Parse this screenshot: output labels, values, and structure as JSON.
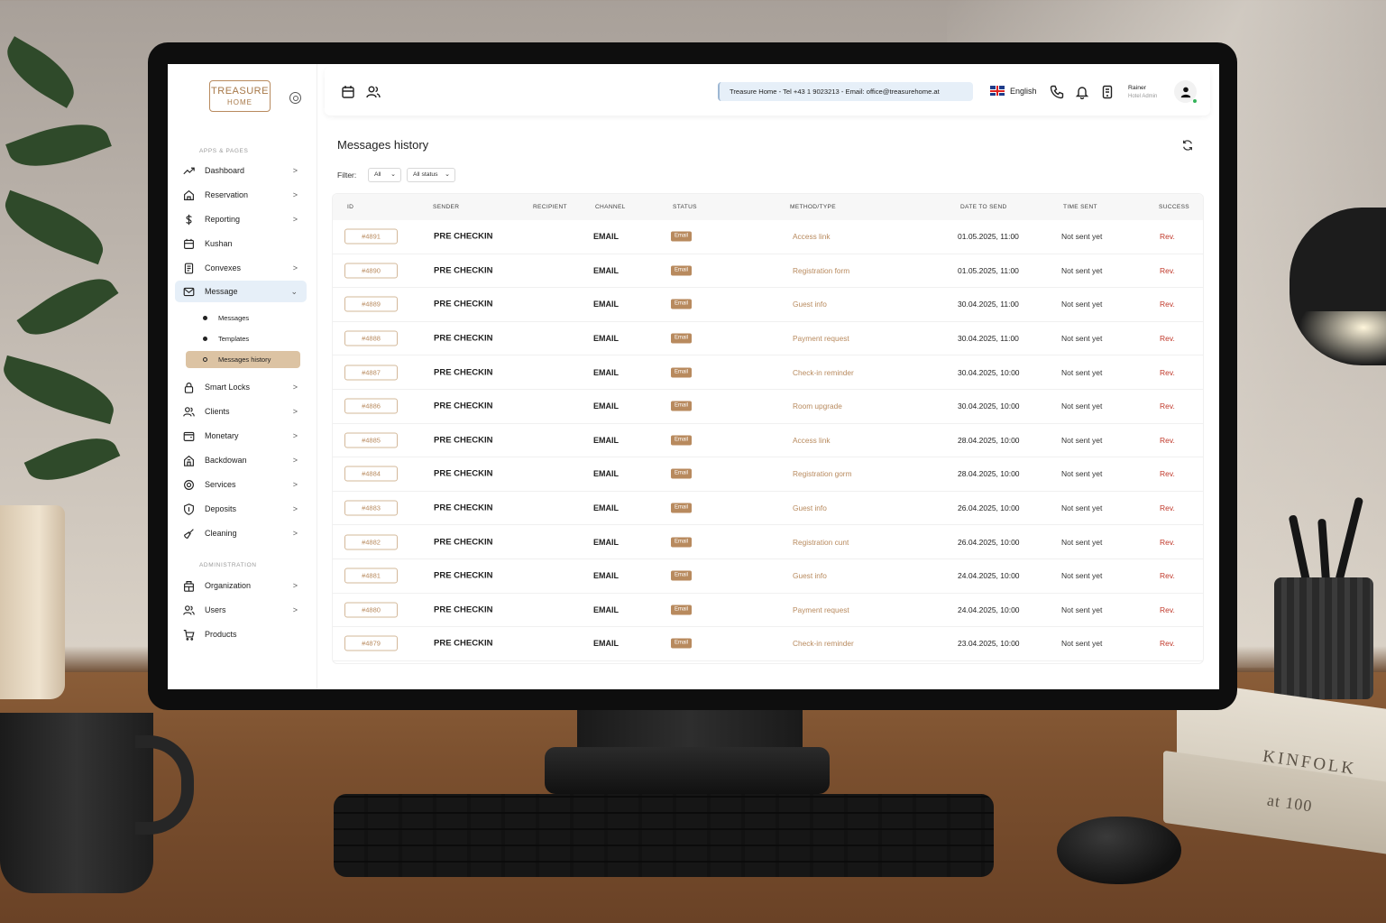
{
  "app": {
    "logo_line1": "TREASURE",
    "logo_line2": "HOME"
  },
  "sidebar": {
    "section_apps": "APPS & PAGES",
    "section_admin": "ADMINISTRATION",
    "items": [
      {
        "label": "Dashboard",
        "icon": "trend-icon",
        "chevron": ">"
      },
      {
        "label": "Reservation",
        "icon": "home-icon",
        "chevron": ">"
      },
      {
        "label": "Reporting",
        "icon": "dollar-icon",
        "chevron": ">"
      },
      {
        "label": "Kushan",
        "icon": "calendar-icon",
        "chevron": ""
      },
      {
        "label": "Convexes",
        "icon": "receipt-icon",
        "chevron": ">"
      },
      {
        "label": "Message",
        "icon": "mail-icon",
        "chevron": "⌄"
      },
      {
        "label": "Smart Locks",
        "icon": "lock-icon",
        "chevron": ">"
      },
      {
        "label": "Clients",
        "icon": "users-icon",
        "chevron": ">"
      },
      {
        "label": "Monetary",
        "icon": "wallet-icon",
        "chevron": ">"
      },
      {
        "label": "Backdowan",
        "icon": "building-icon",
        "chevron": ">"
      },
      {
        "label": "Services",
        "icon": "settings-icon",
        "chevron": ">"
      },
      {
        "label": "Deposits",
        "icon": "shield-icon",
        "chevron": ">"
      },
      {
        "label": "Cleaning",
        "icon": "broom-icon",
        "chevron": ">"
      },
      {
        "label": "Organization",
        "icon": "organization-icon",
        "chevron": ">"
      },
      {
        "label": "Users",
        "icon": "users-icon",
        "chevron": ">"
      },
      {
        "label": "Products",
        "icon": "cart-icon",
        "chevron": ""
      }
    ],
    "sub_items": [
      "Messages",
      "Templates",
      "Messages history"
    ]
  },
  "topbar": {
    "info": "Treasure Home - Tel +43 1 9023213 - Email: office@treasurehome.at",
    "language": "English",
    "user_name": "Rainer",
    "user_role": "Hotel Admin"
  },
  "main": {
    "title": "Messages history",
    "filter_label": "Filter:",
    "filter_all": "All",
    "filter_status": "All status",
    "columns": [
      "ID",
      "SENDER",
      "RECIPIENT",
      "CHANNEL",
      "STATUS",
      "METHOD/TYPE",
      "DATE TO SEND",
      "TIME SENT",
      "SUCCESS"
    ],
    "rows": [
      {
        "id": "#4891",
        "sender": "PRE CHECKIN",
        "recipient": "",
        "channel": "EMAIL",
        "status": "Email",
        "method": "Access link",
        "date": "01.05.2025, 11:00",
        "time_sent": "Not sent yet",
        "success": "Rev."
      },
      {
        "id": "#4890",
        "sender": "PRE CHECKIN",
        "recipient": "",
        "channel": "EMAIL",
        "status": "Email",
        "method": "Registration form",
        "date": "01.05.2025, 11:00",
        "time_sent": "Not sent yet",
        "success": "Rev."
      },
      {
        "id": "#4889",
        "sender": "PRE CHECKIN",
        "recipient": "",
        "channel": "EMAIL",
        "status": "Email",
        "method": "Guest info",
        "date": "30.04.2025, 11:00",
        "time_sent": "Not sent yet",
        "success": "Rev."
      },
      {
        "id": "#4888",
        "sender": "PRE CHECKIN",
        "recipient": "",
        "channel": "EMAIL",
        "status": "Email",
        "method": "Payment request",
        "date": "30.04.2025, 11:00",
        "time_sent": "Not sent yet",
        "success": "Rev."
      },
      {
        "id": "#4887",
        "sender": "PRE CHECKIN",
        "recipient": "",
        "channel": "EMAIL",
        "status": "Email",
        "method": "Check-in reminder",
        "date": "30.04.2025, 10:00",
        "time_sent": "Not sent yet",
        "success": "Rev."
      },
      {
        "id": "#4886",
        "sender": "PRE CHECKIN",
        "recipient": "",
        "channel": "EMAIL",
        "status": "Email",
        "method": "Room upgrade",
        "date": "30.04.2025, 10:00",
        "time_sent": "Not sent yet",
        "success": "Rev."
      },
      {
        "id": "#4885",
        "sender": "PRE CHECKIN",
        "recipient": "",
        "channel": "EMAIL",
        "status": "Email",
        "method": "Access link",
        "date": "28.04.2025, 10:00",
        "time_sent": "Not sent yet",
        "success": "Rev."
      },
      {
        "id": "#4884",
        "sender": "PRE CHECKIN",
        "recipient": "",
        "channel": "EMAIL",
        "status": "Email",
        "method": "Registration gorm",
        "date": "28.04.2025, 10:00",
        "time_sent": "Not sent yet",
        "success": "Rev."
      },
      {
        "id": "#4883",
        "sender": "PRE CHECKIN",
        "recipient": "",
        "channel": "EMAIL",
        "status": "Email",
        "method": "Guest info",
        "date": "26.04.2025, 10:00",
        "time_sent": "Not sent yet",
        "success": "Rev."
      },
      {
        "id": "#4882",
        "sender": "PRE CHECKIN",
        "recipient": "",
        "channel": "EMAIL",
        "status": "Email",
        "method": "Registration cunt",
        "date": "26.04.2025, 10:00",
        "time_sent": "Not sent yet",
        "success": "Rev."
      },
      {
        "id": "#4881",
        "sender": "PRE CHECKIN",
        "recipient": "",
        "channel": "EMAIL",
        "status": "Email",
        "method": "Guest info",
        "date": "24.04.2025, 10:00",
        "time_sent": "Not sent yet",
        "success": "Rev."
      },
      {
        "id": "#4880",
        "sender": "PRE CHECKIN",
        "recipient": "",
        "channel": "EMAIL",
        "status": "Email",
        "method": "Payment request",
        "date": "24.04.2025, 10:00",
        "time_sent": "Not sent yet",
        "success": "Rev."
      },
      {
        "id": "#4879",
        "sender": "PRE CHECKIN",
        "recipient": "",
        "channel": "EMAIL",
        "status": "Email",
        "method": "Check-in reminder",
        "date": "23.04.2025, 10:00",
        "time_sent": "Not sent yet",
        "success": "Rev."
      }
    ]
  },
  "scene": {
    "book_title_1": "KINFOLK",
    "book_title_2": "at 100"
  },
  "colors": {
    "accent": "#b88a5e",
    "active_nav": "#e6eff8",
    "active_sub": "#dcc3a3",
    "success_text": "#c0392b"
  }
}
